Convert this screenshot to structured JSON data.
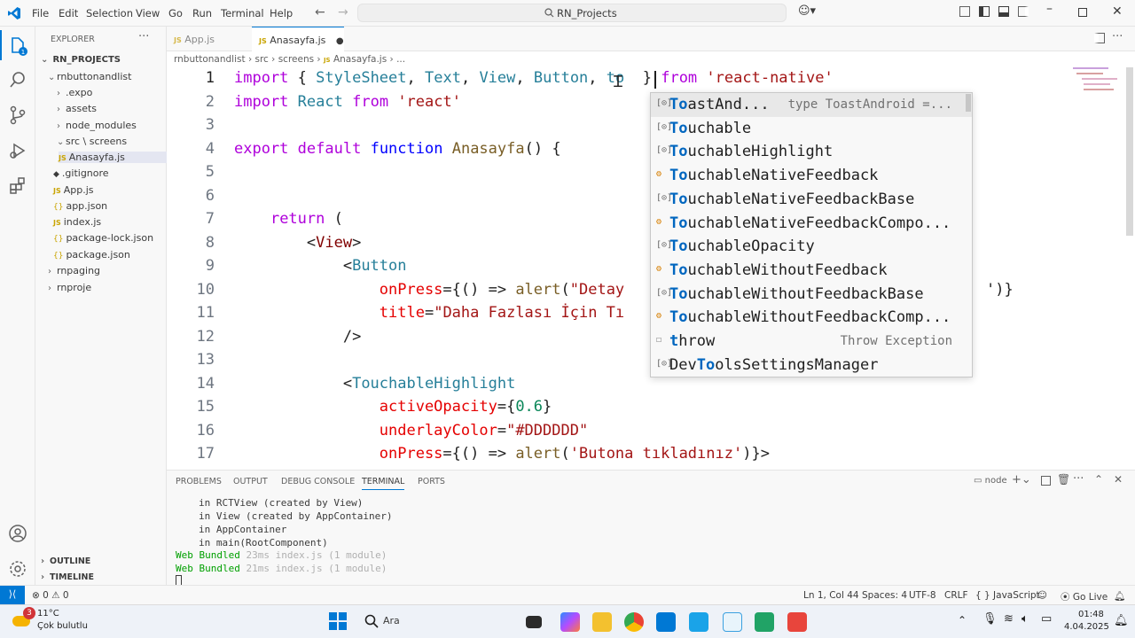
{
  "titlebar": {
    "menu": [
      "File",
      "Edit",
      "Selection",
      "View",
      "Go",
      "Run",
      "Terminal",
      "Help"
    ],
    "search_text": "RN_Projects"
  },
  "sidebar": {
    "header": "EXPLORER",
    "root": "RN_PROJECTS",
    "items": [
      {
        "label": "rnbuttonandlist",
        "kind": "folder-open"
      },
      {
        "label": ".expo",
        "kind": "folder"
      },
      {
        "label": "assets",
        "kind": "folder"
      },
      {
        "label": "node_modules",
        "kind": "folder"
      },
      {
        "label": "src \\ screens",
        "kind": "folder-open"
      },
      {
        "label": "Anasayfa.js",
        "kind": "js"
      },
      {
        "label": ".gitignore",
        "kind": "git"
      },
      {
        "label": "App.js",
        "kind": "js"
      },
      {
        "label": "app.json",
        "kind": "json"
      },
      {
        "label": "index.js",
        "kind": "js"
      },
      {
        "label": "package-lock.json",
        "kind": "json"
      },
      {
        "label": "package.json",
        "kind": "json"
      },
      {
        "label": "rnpaging",
        "kind": "folder"
      },
      {
        "label": "rnproje",
        "kind": "folder"
      }
    ],
    "outline": "OUTLINE",
    "timeline": "TIMELINE"
  },
  "tabs": [
    {
      "label": "App.js",
      "active": false
    },
    {
      "label": "Anasayfa.js",
      "active": true,
      "dirty": true
    }
  ],
  "breadcrumb": [
    "rnbuttonandlist",
    "src",
    "screens",
    "Anasayfa.js",
    "..."
  ],
  "editor": {
    "lines": [
      "1",
      "2",
      "3",
      "4",
      "5",
      "6",
      "7",
      "8",
      "9",
      "10",
      "11",
      "12",
      "13",
      "14",
      "15",
      "16",
      "17"
    ]
  },
  "suggest": [
    {
      "match": "To",
      "rest": "astAnd...",
      "detail": "type ToastAndroid =...",
      "icon": "symbol-variable-icon"
    },
    {
      "match": "To",
      "rest": "uchable",
      "detail": "",
      "icon": "symbol-variable-icon"
    },
    {
      "match": "To",
      "rest": "uchableHighlight",
      "detail": "",
      "icon": "symbol-variable-icon"
    },
    {
      "match": "To",
      "rest": "uchableNativeFeedback",
      "detail": "",
      "icon": "symbol-class-icon"
    },
    {
      "match": "To",
      "rest": "uchableNativeFeedbackBase",
      "detail": "",
      "icon": "symbol-variable-icon"
    },
    {
      "match": "To",
      "rest": "uchableNativeFeedbackCompo...",
      "detail": "",
      "icon": "symbol-class-icon"
    },
    {
      "match": "To",
      "rest": "uchableOpacity",
      "detail": "",
      "icon": "symbol-variable-icon"
    },
    {
      "match": "To",
      "rest": "uchableWithoutFeedback",
      "detail": "",
      "icon": "symbol-class-icon"
    },
    {
      "match": "To",
      "rest": "uchableWithoutFeedbackBase",
      "detail": "",
      "icon": "symbol-variable-icon"
    },
    {
      "match": "To",
      "rest": "uchableWithoutFeedbackComp...",
      "detail": "",
      "icon": "symbol-class-icon"
    },
    {
      "match": "t",
      "rest": "hrow",
      "detail": "Throw Exception",
      "icon": "symbol-keyword-icon"
    },
    {
      "match": "DevTo",
      "rest": "olsSettingsManager",
      "detail": "",
      "icon": "symbol-variable-icon"
    }
  ],
  "panel": {
    "tabs": [
      "PROBLEMS",
      "OUTPUT",
      "DEBUG CONSOLE",
      "TERMINAL",
      "PORTS"
    ],
    "active_tab": "TERMINAL",
    "terminal_lines": [
      "in RCTView (created by View)",
      "in View (created by AppContainer)",
      "in AppContainer",
      "in main(RootComponent)"
    ],
    "bundled": [
      {
        "prefix": "Web Bundled",
        "rest": " 23ms index.js (1 module)"
      },
      {
        "prefix": "Web Bundled",
        "rest": " 21ms index.js (1 module)"
      }
    ],
    "terminal_name": "node"
  },
  "statusbar": {
    "problems": "⊗ 0 ⚠ 0",
    "position": "Ln 1, Col 44",
    "spaces": "Spaces: 4",
    "encoding": "UTF-8",
    "eol": "CRLF",
    "language": "{ } JavaScript",
    "golive": "Go Live"
  },
  "taskbar": {
    "weather_temp": "11°C",
    "weather_desc": "Çok bulutlu",
    "weather_badge": "3",
    "search": "Ara",
    "time": "01:48",
    "date": "4.04.2025"
  },
  "colors": {
    "accent": "#0078d4",
    "keyword": "#af00db",
    "string": "#a31515",
    "tag": "#800000",
    "attribute": "#e50000"
  }
}
